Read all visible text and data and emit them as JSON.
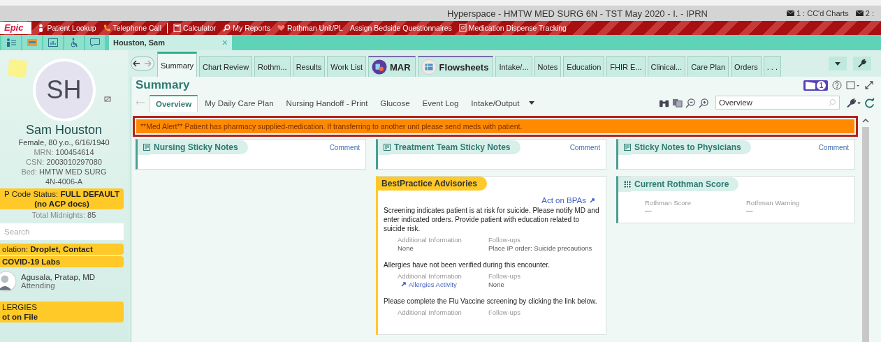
{
  "window": {
    "title": "Hyperspace - HMTW MED SURG 6N - TST May 2020 -  I. - IPRN",
    "messages": [
      "1 : CC'd Charts",
      "2 :"
    ]
  },
  "toolbar": {
    "logo": "Epic",
    "items": [
      {
        "label": "Patient Lookup",
        "kind": "person"
      },
      {
        "label": "Telephone Call",
        "kind": "phone"
      },
      {
        "label": "Calculator",
        "kind": "calculator"
      },
      {
        "label": "My Reports",
        "kind": "search"
      },
      {
        "label": "Rothman Unit/PL",
        "kind": "heart"
      },
      {
        "label": "Assign Bedside Questionnaires",
        "kind": "plain"
      },
      {
        "label": "Medication Dispense Tracking",
        "kind": "doc"
      }
    ]
  },
  "patient_tab": {
    "label": "Houston, Sam",
    "close": "×"
  },
  "sidebar": {
    "initials": "SH",
    "name": "Sam Houston",
    "demographics": "Female, 80 y.o., 6/16/1940",
    "fields": [
      {
        "label": "MRN:",
        "value": "100454614"
      },
      {
        "label": "CSN:",
        "value": "2003010297080"
      },
      {
        "label": "Bed:",
        "value": "HMTW MED SURG 4N-4006-A"
      }
    ],
    "code_status": "P Code Status: **FULL DEFAULT (no ACP docs)**",
    "midnights": {
      "label": "Total Midnights:",
      "value": "85"
    },
    "search": {
      "placeholder": "Search"
    },
    "isolation": "olation: **Droplet, Contact**",
    "labs": "COVID-19 Labs",
    "provider": {
      "name": "Agusala, Pratap, MD",
      "role": "Attending"
    },
    "allergies": {
      "title": "LERGIES",
      "value": "ot on File"
    }
  },
  "activity_tabs": [
    {
      "label": "Summary",
      "kind": "plain",
      "selected": true
    },
    {
      "label": "Chart Review",
      "kind": "plain",
      "selected": false
    },
    {
      "label": "Rothm...",
      "kind": "plain",
      "selected": false
    },
    {
      "label": "Results",
      "kind": "plain",
      "selected": false
    },
    {
      "label": "Work List",
      "kind": "plain",
      "selected": false
    },
    {
      "label": "MAR",
      "kind": "mar",
      "selected": false
    },
    {
      "label": "Flowsheets",
      "kind": "flowsheets",
      "selected": false
    },
    {
      "label": "Intake/...",
      "kind": "plain",
      "selected": false
    },
    {
      "label": "Notes",
      "kind": "plain",
      "selected": false
    },
    {
      "label": "Education",
      "kind": "plain",
      "selected": false
    },
    {
      "label": "FHIR E...",
      "kind": "plain",
      "selected": false
    },
    {
      "label": "Clinical...",
      "kind": "plain",
      "selected": false
    },
    {
      "label": "Care Plan",
      "kind": "plain",
      "selected": false
    },
    {
      "label": "Orders",
      "kind": "plain",
      "selected": false
    },
    {
      "label": ". . .",
      "kind": "more",
      "selected": false
    }
  ],
  "summary": {
    "title": "Summary",
    "badge": "1",
    "subtabs": [
      {
        "label": "Overview",
        "selected": true
      },
      {
        "label": "My Daily Care Plan",
        "selected": false
      },
      {
        "label": "Nursing Handoff - Print",
        "selected": false
      },
      {
        "label": "Glucose",
        "selected": false
      },
      {
        "label": "Event Log",
        "selected": false
      },
      {
        "label": "Intake/Output",
        "selected": false
      }
    ],
    "search_value": "Overview",
    "alert": "**Med Alert** Patient has pharmacy supplied-medication. If transferring to another unit please send meds with patient."
  },
  "sticky_cards": [
    {
      "title": "Nursing Sticky Notes",
      "action": "Comment"
    },
    {
      "title": "Treatment Team Sticky Notes",
      "action": "Comment"
    },
    {
      "title": "Sticky Notes to Physicians",
      "action": "Comment"
    }
  ],
  "bpa": {
    "title": "BestPractice Advisories",
    "action": "Act on BPAs",
    "advisories": [
      {
        "message": "Screening indicates patient is at risk for suicide. Please notify MD and enter indicated orders. Provide patient with education related to suicide risk.",
        "info_label": "Additional Information",
        "followup_label": "Follow-ups",
        "info": {
          "text": "None",
          "kind": "plain"
        },
        "followup": "Place IP order: Suicide precautions"
      },
      {
        "message": "Allergies have not been verified during this encounter.",
        "info_label": "Additional Information",
        "followup_label": "Follow-ups",
        "info": {
          "text": "Allergies Activity",
          "kind": "link"
        },
        "followup": "None"
      },
      {
        "message": "Please complete the Flu Vaccine screening by clicking the link below.",
        "info_label": "Additional Information",
        "followup_label": "Follow-ups"
      }
    ]
  },
  "rothman": {
    "title": "Current Rothman Score",
    "columns": [
      {
        "label": "Rothman Score",
        "value": "—"
      },
      {
        "label": "Rothman Warning",
        "value": "—"
      }
    ]
  }
}
